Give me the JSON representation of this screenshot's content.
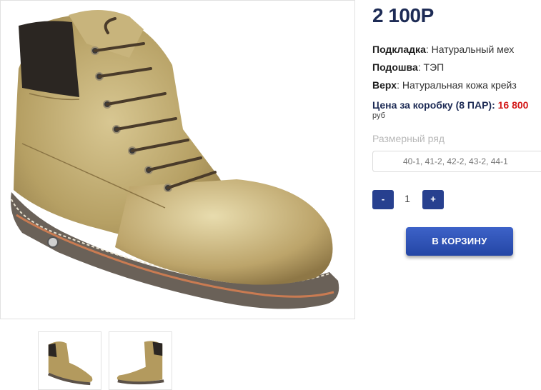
{
  "product": {
    "price": "2 100Р",
    "specs": [
      {
        "label": "Подкладка",
        "value": "Натуральный мех"
      },
      {
        "label": "Подошва",
        "value": "ТЭП"
      },
      {
        "label": "Верх",
        "value": "Натуральная кожа крейз"
      }
    ],
    "box_price_label": "Цена за коробку (8 ПАР):",
    "box_price_value": "16 800",
    "box_price_currency": "руб",
    "size_label": "Размерный ряд",
    "size_value": "40-1, 41-2, 42-2, 43-2, 44-1"
  },
  "quantity": {
    "minus_label": "-",
    "value": "1",
    "plus_label": "+"
  },
  "cart_button_label": "В КОРЗИНУ",
  "colors": {
    "price": "#1d2b55",
    "accent_red": "#d31a1a",
    "button_blue": "#27408f",
    "leather": "#b39a5e",
    "collar": "#2b2622",
    "sole": "#5b5148"
  },
  "images": {
    "main": "boot-photo",
    "thumbnails": [
      "boot-front-thumb",
      "boot-side-thumb"
    ]
  }
}
